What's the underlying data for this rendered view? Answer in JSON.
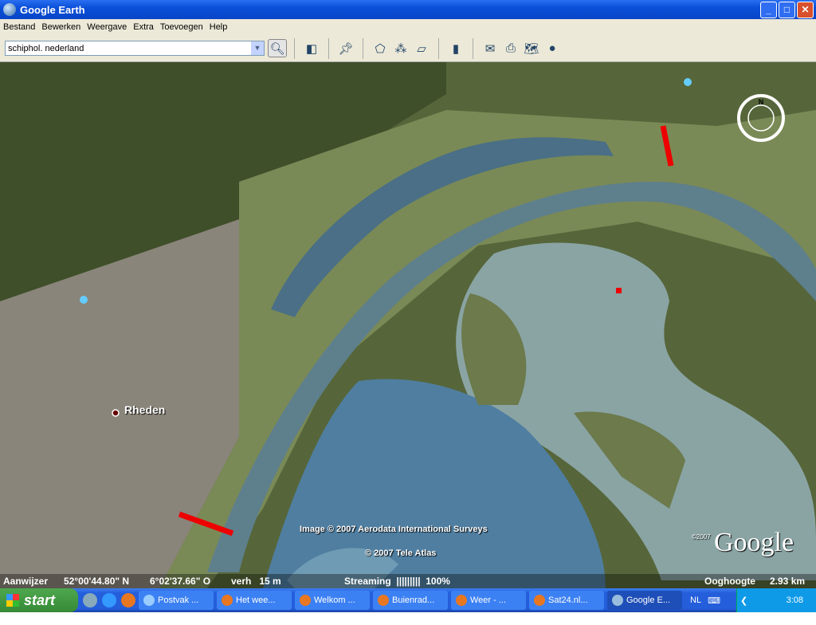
{
  "window": {
    "title": "Google Earth"
  },
  "menu": [
    "Bestand",
    "Bewerken",
    "Weergave",
    "Extra",
    "Toevoegen",
    "Help"
  ],
  "search": {
    "value": "schiphol. nederland"
  },
  "map": {
    "place_label": "Rheden",
    "credit1": "Image © 2007 Aerodata International Surveys",
    "credit2": "© 2007 Tele Atlas",
    "logo": "Google",
    "copyright": "©2007"
  },
  "status": {
    "pointer_label": "Aanwijzer",
    "lat": "52°00'44.80\" N",
    "lon": "6°02'37.66\" O",
    "elev": "verh   15 m",
    "streaming": "Streaming  |||||||||  100%",
    "eye_label": "Ooghoogte",
    "eye_value": "2.93 km"
  },
  "taskbar": {
    "start": "start",
    "tasks": [
      "Postvak ...",
      "Het wee...",
      "Welkom ...",
      "Buienrad...",
      "Weer - ...",
      "Sat24.nl...",
      "Google E..."
    ],
    "lang": "NL",
    "time": "3:08"
  }
}
